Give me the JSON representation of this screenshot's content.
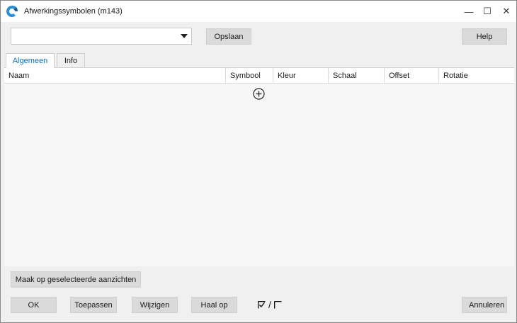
{
  "window": {
    "title": "Afwerkingssymbolen (m143)",
    "minimize_glyph": "—",
    "maximize_glyph": "☐",
    "close_glyph": "✕"
  },
  "toolbar": {
    "combo_value": "",
    "save_label": "Opslaan",
    "help_label": "Help"
  },
  "tabs": [
    {
      "label": "Algemeen",
      "active": true
    },
    {
      "label": "Info",
      "active": false
    }
  ],
  "grid": {
    "columns": [
      "Naam",
      "Symbool",
      "Kleur",
      "Schaal",
      "Offset",
      "Rotatie"
    ],
    "rows": []
  },
  "footer": {
    "apply_selected_label": "Maak op geselecteerde aanzichten",
    "ok_label": "OK",
    "apply_label": "Toepassen",
    "modify_label": "Wijzigen",
    "fetch_label": "Haal op",
    "toggle_separator": "/",
    "cancel_label": "Annuleren"
  },
  "colors": {
    "accent": "#1a6fb0",
    "button_bg": "#dadada",
    "panel_bg": "#f0f0f0"
  }
}
